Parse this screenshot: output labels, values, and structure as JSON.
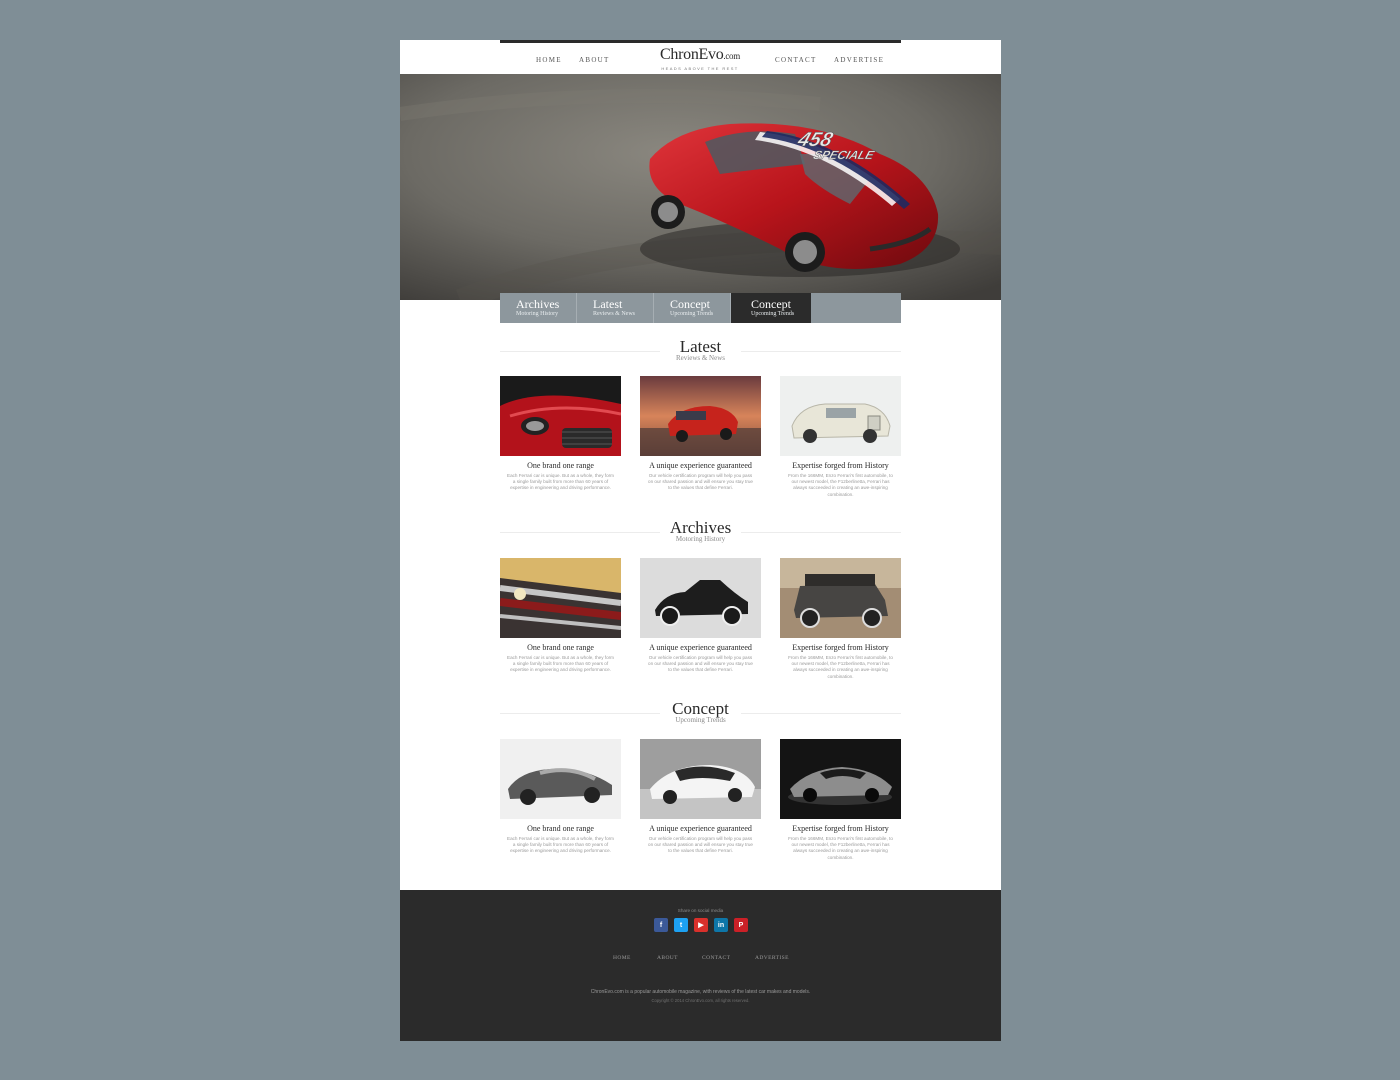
{
  "nav": {
    "home": "HOME",
    "about": "ABOUT",
    "contact": "CONTACT",
    "advertise": "ADVERTISE"
  },
  "logo": {
    "name": "ChronEvo",
    "suffix": ".com",
    "tagline": "HEADS ABOVE THE REST"
  },
  "hero": {
    "badge_line1": "458",
    "badge_line2": "SPECIALE"
  },
  "tabs": [
    {
      "title": "Archives",
      "subtitle": "Motoring History"
    },
    {
      "title": "Latest",
      "subtitle": "Reviews & News"
    },
    {
      "title": "Concept",
      "subtitle": "Upcoming Trends"
    },
    {
      "title": "Concept",
      "subtitle": "Upcoming Trends"
    }
  ],
  "sections": [
    {
      "title": "Latest",
      "subtitle": "Reviews & News",
      "cards": [
        {
          "title": "One brand one range",
          "text": "Each Ferrari car is unique. But as a whole, they form a single family built from more than 60 years of expertise in engineering and driving performance."
        },
        {
          "title": "A unique experience guaranteed",
          "text": "Our vehicle certification program will help you pass on our shared passion and will ensure you stay true to the values that define Ferrari."
        },
        {
          "title": "Expertise forged from History",
          "text": "From the 166MM, Enzo Ferrari's first automobile, to our newest model, the F12berlinetta, Ferrari has always succeeded in creating an awe-inspiring combination."
        }
      ]
    },
    {
      "title": "Archives",
      "subtitle": "Motoring History",
      "cards": [
        {
          "title": "One brand one range",
          "text": "Each Ferrari car is unique. But as a whole, they form a single family built from more than 60 years of expertise in engineering and driving performance."
        },
        {
          "title": "A unique experience guaranteed",
          "text": "Our vehicle certification program will help you pass on our shared passion and will ensure you stay true to the values that define Ferrari."
        },
        {
          "title": "Expertise forged from History",
          "text": "From the 166MM, Enzo Ferrari's first automobile, to our newest model, the F12berlinetta, Ferrari has always succeeded in creating an awe-inspiring combination."
        }
      ]
    },
    {
      "title": "Concept",
      "subtitle": "Upcoming Trends",
      "cards": [
        {
          "title": "One brand one range",
          "text": "Each Ferrari car is unique. But as a whole, they form a single family built from more than 60 years of expertise in engineering and driving performance."
        },
        {
          "title": "A unique experience guaranteed",
          "text": "Our vehicle certification program will help you pass on our shared passion and will ensure you stay true to the values that define Ferrari."
        },
        {
          "title": "Expertise forged from History",
          "text": "From the 166MM, Enzo Ferrari's first automobile, to our newest model, the F12berlinetta, Ferrari has always succeeded in creating an awe-inspiring combination."
        }
      ]
    }
  ],
  "footer": {
    "share_label": "Share on social media",
    "social": [
      {
        "icon": "facebook-icon",
        "glyph": "f",
        "color": "#3b5998"
      },
      {
        "icon": "twitter-icon",
        "glyph": "t",
        "color": "#1da1f2"
      },
      {
        "icon": "youtube-icon",
        "glyph": "▶",
        "color": "#d9302b"
      },
      {
        "icon": "linkedin-icon",
        "glyph": "in",
        "color": "#0e76a8"
      },
      {
        "icon": "pinterest-icon",
        "glyph": "P",
        "color": "#cb2027"
      }
    ],
    "nav": {
      "home": "HOME",
      "about": "ABOUT",
      "contact": "CONTACT",
      "advertise": "ADVERTISE"
    },
    "description": "ChronEvo.com is a popular automobile magazine, with reviews of the latest car makes and models.",
    "copyright": "Copyright © 2014 ChronEvo.com, all rights reserved."
  },
  "colors": {
    "background": "#7f8e96",
    "tab_strip": "#8d979d",
    "tab_active": "#2b2b2b",
    "footer": "#2b2b2b",
    "accent_red": "#c8161d"
  }
}
